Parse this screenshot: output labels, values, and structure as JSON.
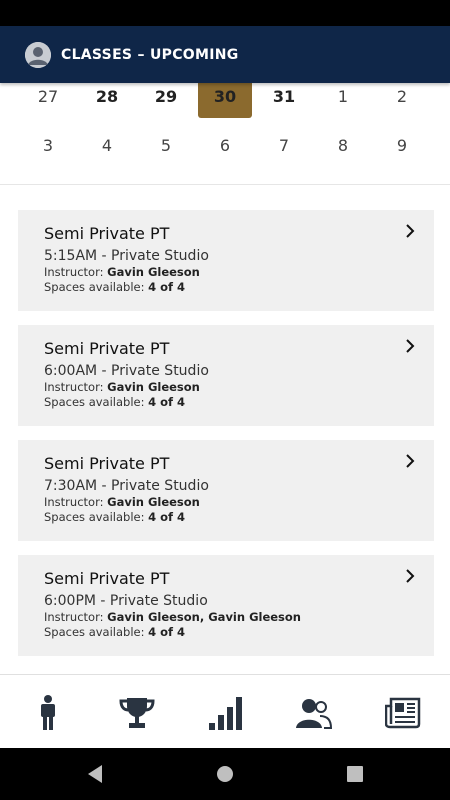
{
  "header": {
    "title": "CLASSES – UPCOMING"
  },
  "calendar": {
    "week1": [
      "27",
      "28",
      "29",
      "30",
      "31",
      "1",
      "2"
    ],
    "week2": [
      "3",
      "4",
      "5",
      "6",
      "7",
      "8",
      "9"
    ],
    "selected": "30",
    "selected_color": "#8b6a2e"
  },
  "classes": [
    {
      "name": "Semi Private PT",
      "time": "5:15AM - Private Studio",
      "instructor_label": "Instructor:",
      "instructor": "Gavin Gleeson",
      "spaces_label": "Spaces available:",
      "spaces": "4 of 4"
    },
    {
      "name": "Semi Private PT",
      "time": "6:00AM - Private Studio",
      "instructor_label": "Instructor:",
      "instructor": "Gavin Gleeson",
      "spaces_label": "Spaces available:",
      "spaces": "4 of 4"
    },
    {
      "name": "Semi Private PT",
      "time": "7:30AM - Private Studio",
      "instructor_label": "Instructor:",
      "instructor": "Gavin Gleeson",
      "spaces_label": "Spaces available:",
      "spaces": "4 of 4"
    },
    {
      "name": "Semi Private PT",
      "time": "6:00PM - Private Studio",
      "instructor_label": "Instructor:",
      "instructor": "Gavin Gleeson, Gavin Gleeson",
      "spaces_label": "Spaces available:",
      "spaces": "4 of 4"
    }
  ],
  "bottom_nav": [
    "person-icon",
    "trophy-icon",
    "stats-icon",
    "users-icon",
    "news-icon"
  ],
  "colors": {
    "header_bg": "#0f2648",
    "accent": "#8b6a2e",
    "card_bg": "#f0f0f0",
    "icon": "#2a3441"
  }
}
